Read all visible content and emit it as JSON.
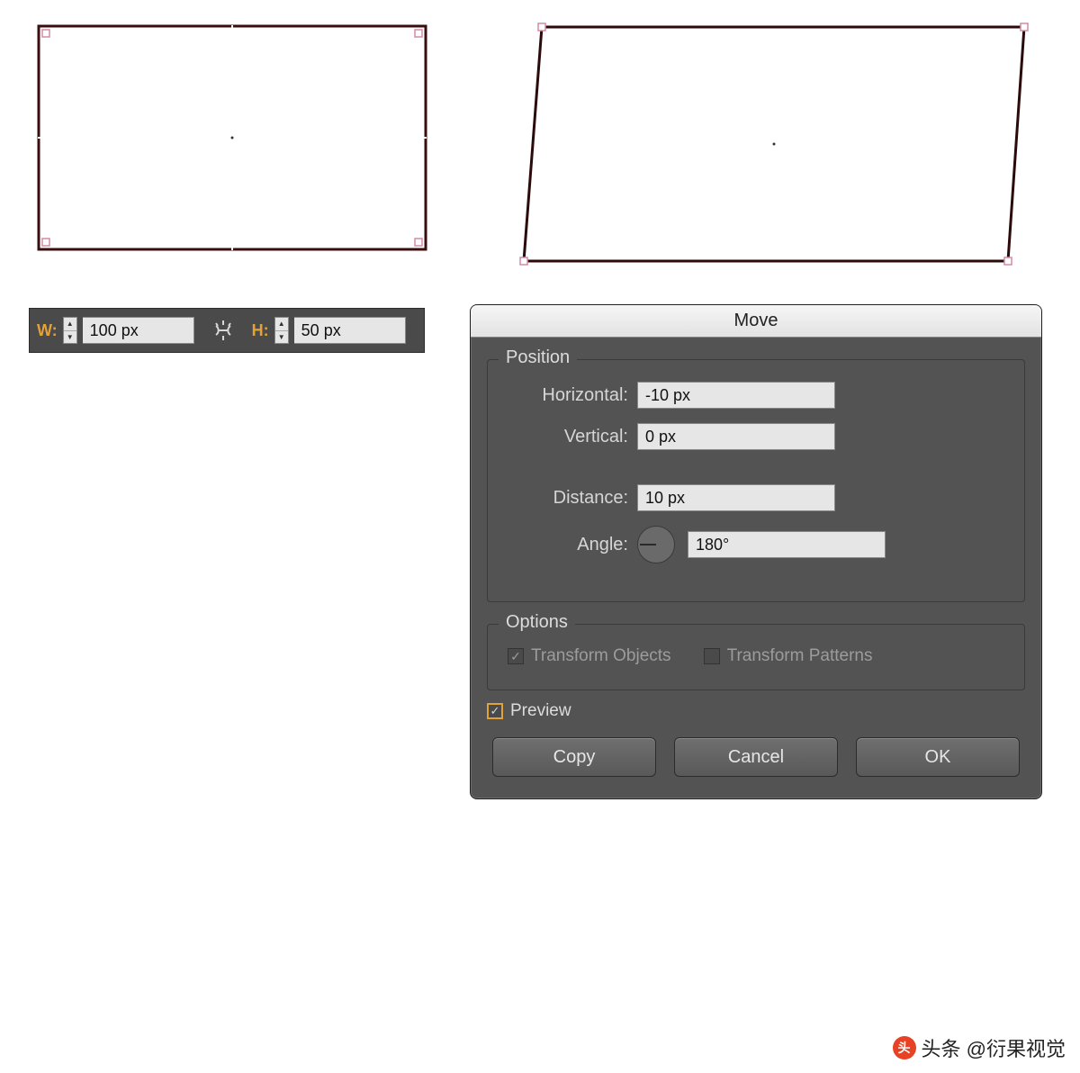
{
  "canvas": {
    "left": {
      "anchors_visible": true
    },
    "right": {
      "skewed": true
    }
  },
  "wh_bar": {
    "w_label": "W:",
    "w_value": "100 px",
    "h_label": "H:",
    "h_value": "50 px"
  },
  "move_dialog": {
    "title": "Move",
    "position_legend": "Position",
    "horizontal_label": "Horizontal:",
    "horizontal_value": "-10 px",
    "vertical_label": "Vertical:",
    "vertical_value": "0 px",
    "distance_label": "Distance:",
    "distance_value": "10 px",
    "angle_label": "Angle:",
    "angle_value": "180°",
    "options_legend": "Options",
    "transform_objects_label": "Transform Objects",
    "transform_objects_checked": true,
    "transform_patterns_label": "Transform Patterns",
    "transform_patterns_checked": false,
    "preview_label": "Preview",
    "preview_checked": true,
    "copy_btn": "Copy",
    "cancel_btn": "Cancel",
    "ok_btn": "OK"
  },
  "watermark": {
    "text": "头条 @衍果视觉"
  }
}
